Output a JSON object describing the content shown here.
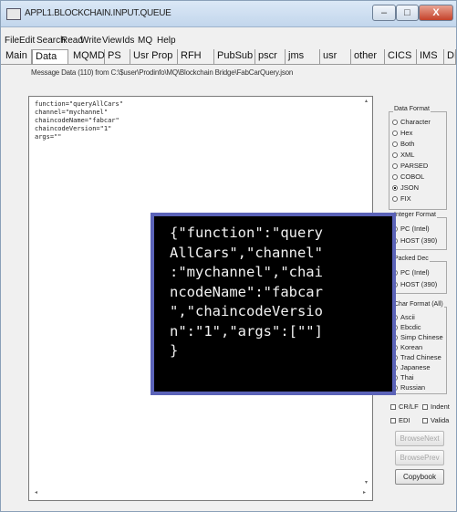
{
  "window": {
    "title": "APPL1.BLOCKCHAIN.INPUT.QUEUE",
    "minimize_glyph": "–",
    "maximize_glyph": "□",
    "close_glyph": "X"
  },
  "menu": [
    "File",
    "Edit",
    "Search",
    "Read",
    "Write",
    "View",
    "Ids",
    "MQ",
    "Help"
  ],
  "tabs": [
    {
      "label": "Main"
    },
    {
      "label": "Data"
    },
    {
      "label": "MQMD"
    },
    {
      "label": "PS"
    },
    {
      "label": "Usr Prop"
    },
    {
      "label": "RFH"
    },
    {
      "label": "PubSub"
    },
    {
      "label": "pscr"
    },
    {
      "label": "jms"
    },
    {
      "label": "usr"
    },
    {
      "label": "other"
    },
    {
      "label": "CICS"
    },
    {
      "label": "IMS"
    },
    {
      "label": "DLQ"
    }
  ],
  "status_text": "Message Data (110) from C:\\$user\\Prodinfo\\MQ\\Blockchain Bridge\\FabCarQuery.json",
  "editor_lines": [
    "function=\"queryAllCars\"",
    "channel=\"mychannel\"",
    "chaincodeName=\"fabcar\"",
    "chaincodeVersion=\"1\"",
    "args=\"\""
  ],
  "data_format": {
    "title": "Data Format",
    "options": [
      "Character",
      "Hex",
      "Both",
      "XML",
      "PARSED",
      "COBOL",
      "JSON",
      "FIX"
    ],
    "selected": "JSON"
  },
  "integer_format": {
    "title": "Integer Format",
    "options": [
      "PC (Intel)",
      "HOST (390)"
    ],
    "selected": "PC (Intel)"
  },
  "packed_dec": {
    "title": "Packed Dec",
    "options": [
      "PC (Intel)",
      "HOST (390)"
    ]
  },
  "char_format": {
    "title": "Char Format (All)",
    "options": [
      "Ascii",
      "Ebcdic",
      "Simp Chinese",
      "Korean",
      "Trad Chinese",
      "Japanese",
      "Thai",
      "Russian"
    ]
  },
  "checkboxes": [
    "CR/LF",
    "Indent",
    "EDI",
    "Valida"
  ],
  "buttons": {
    "browse_next": "BrowseNext",
    "browse_prev": "BrowsePrev",
    "copybook": "Copybook"
  },
  "overlay_lines": [
    "{\"function\":\"query",
    "AllCars\",\"channel\"",
    ":\"mychannel\",\"chai",
    "ncodeName\":\"fabcar",
    "\",\"chaincodeVersio",
    "n\":\"1\",\"args\":[\"\"]",
    "}"
  ]
}
